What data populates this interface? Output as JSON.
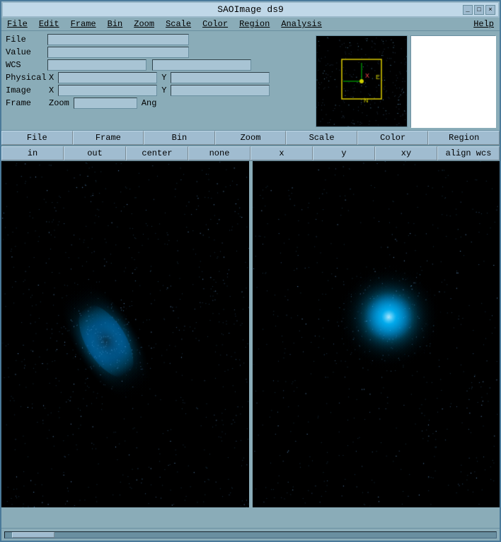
{
  "window": {
    "title": "SAOImage ds9",
    "minimize_label": "_",
    "maximize_label": "□",
    "close_label": "×"
  },
  "menu": {
    "items": [
      "File",
      "Edit",
      "Frame",
      "Bin",
      "Zoom",
      "Scale",
      "Color",
      "Region",
      "Analysis",
      "Help"
    ]
  },
  "info": {
    "file_label": "File",
    "value_label": "Value",
    "wcs_label": "WCS",
    "physical_label": "Physical",
    "image_label": "Image",
    "frame_label": "Frame",
    "zoom_label": "Zoom",
    "ang_label": "Ang",
    "x_label": "X",
    "y_label": "Y"
  },
  "toolbar1": {
    "buttons": [
      "File",
      "Frame",
      "Bin",
      "Zoom",
      "Scale",
      "Color",
      "Region"
    ]
  },
  "toolbar2": {
    "buttons": [
      "in",
      "out",
      "center",
      "none",
      "x",
      "y",
      "xy",
      "align wcs"
    ]
  },
  "scrollbar": {
    "label": ""
  }
}
